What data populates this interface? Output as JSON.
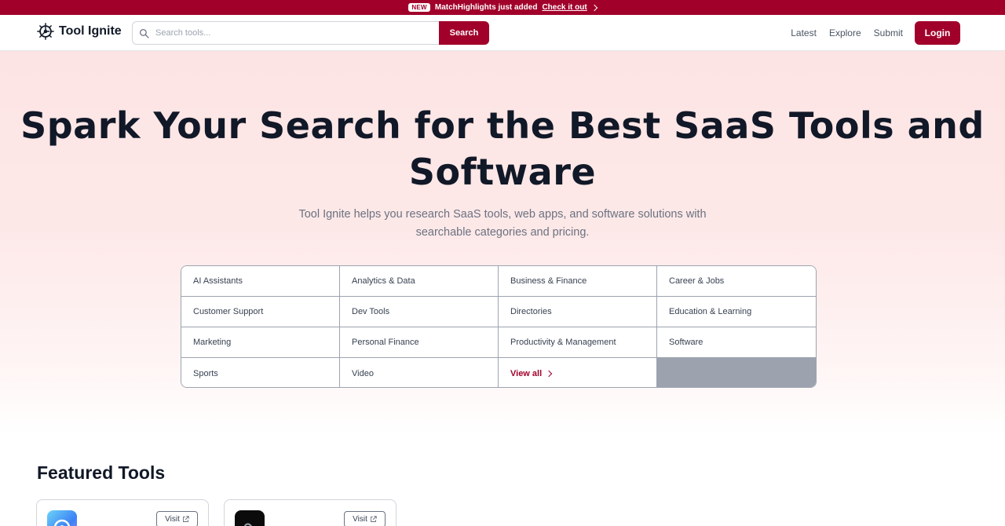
{
  "announcement": {
    "badge": "NEW",
    "text": "MatchHighlights just added",
    "link": "Check it out"
  },
  "header": {
    "logo_text": "Tool Ignite",
    "search_placeholder": "Search tools...",
    "search_button": "Search",
    "nav": [
      "Latest",
      "Explore",
      "Submit"
    ],
    "login": "Login"
  },
  "hero": {
    "title_line1": "Spark Your Search for the Best SaaS Tools and",
    "title_line2": "Software",
    "subtitle_line1": "Tool Ignite helps you research SaaS tools, web apps, and software solutions with",
    "subtitle_line2": "searchable categories and pricing."
  },
  "categories": [
    "AI Assistants",
    "Analytics & Data",
    "Business & Finance",
    "Career & Jobs",
    "Customer Support",
    "Dev Tools",
    "Directories",
    "Education & Learning",
    "Marketing",
    "Personal Finance",
    "Productivity & Management",
    "Software",
    "Sports",
    "Video"
  ],
  "view_all": "View all",
  "featured": {
    "title": "Featured Tools",
    "cards": [
      {
        "visit": "Visit",
        "icon": "gear-app-icon"
      },
      {
        "visit": "Visit",
        "icon": "link-app-icon"
      }
    ]
  },
  "colors": {
    "brand": "#a1002a",
    "hero_bg": "#fde4e4"
  }
}
